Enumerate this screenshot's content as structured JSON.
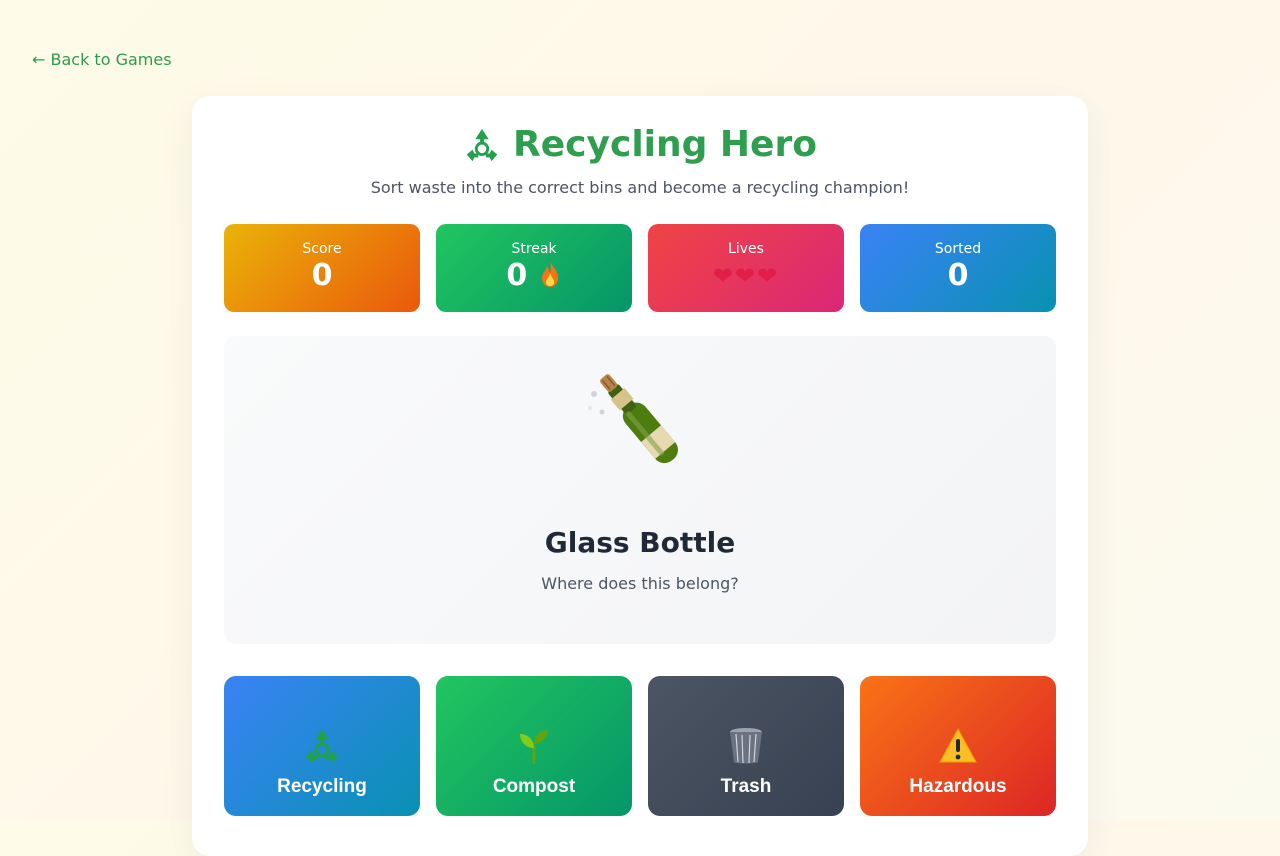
{
  "nav": {
    "back_label": "← Back to Games"
  },
  "header": {
    "title": "Recycling Hero",
    "title_icon": "recycle-icon",
    "subtitle": "Sort waste into the correct bins and become a recycling champion!"
  },
  "stats": {
    "score": {
      "label": "Score",
      "value": "0"
    },
    "streak": {
      "label": "Streak",
      "value": "0",
      "icon": "fire-icon"
    },
    "lives": {
      "label": "Lives",
      "value": "❤❤❤",
      "count": 3
    },
    "sorted": {
      "label": "Sorted",
      "value": "0"
    }
  },
  "item": {
    "icon": "champagne-bottle-icon",
    "name": "Glass Bottle",
    "question": "Where does this belong?"
  },
  "bins": [
    {
      "label": "Recycling",
      "icon": "recycle-icon",
      "color": "#3b82f6"
    },
    {
      "label": "Compost",
      "icon": "seedling-icon",
      "color": "#22c55e"
    },
    {
      "label": "Trash",
      "icon": "wastebasket-icon",
      "color": "#4b5563"
    },
    {
      "label": "Hazardous",
      "icon": "warning-icon",
      "color": "#f97316"
    }
  ],
  "colors": {
    "accent": "#2e9e4f",
    "link": "#2c9c4a"
  }
}
